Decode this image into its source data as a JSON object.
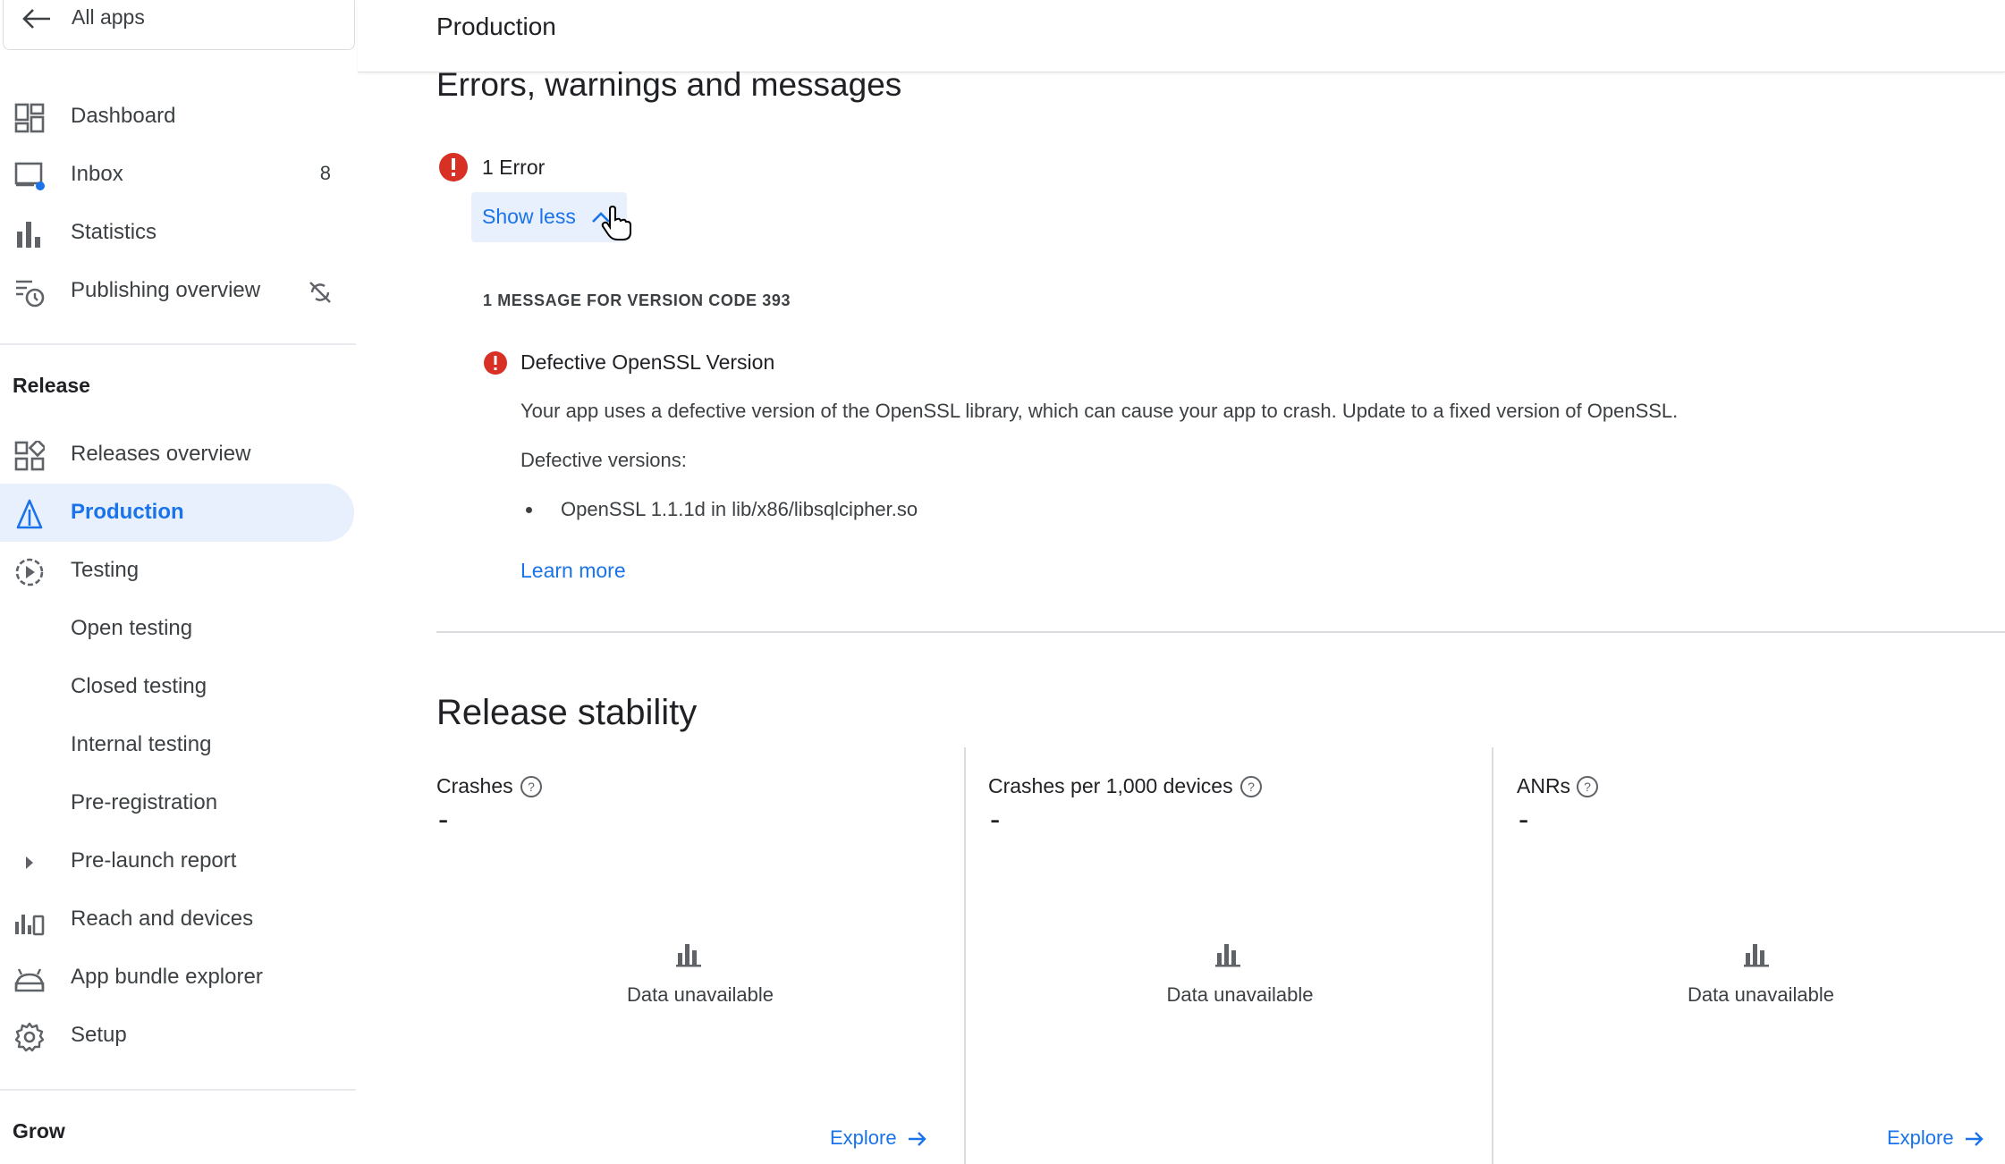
{
  "sidebar": {
    "all_apps": "All apps",
    "items": [
      {
        "label": "Dashboard",
        "icon": "dashboard-icon"
      },
      {
        "label": "Inbox",
        "icon": "inbox-icon",
        "count": "8"
      },
      {
        "label": "Statistics",
        "icon": "bar-chart-icon"
      },
      {
        "label": "Publishing overview",
        "icon": "publishing-overview-icon"
      }
    ],
    "release_heading": "Release",
    "release_items": [
      {
        "label": "Releases overview",
        "icon": "releases-overview-icon"
      },
      {
        "label": "Production",
        "icon": "production-icon",
        "active": true
      },
      {
        "label": "Testing",
        "icon": "testing-icon"
      },
      {
        "label": "Open testing"
      },
      {
        "label": "Closed testing"
      },
      {
        "label": "Internal testing"
      },
      {
        "label": "Pre-registration"
      },
      {
        "label": "Pre-launch report",
        "icon": "expand-arrow-icon"
      },
      {
        "label": "Reach and devices",
        "icon": "reach-devices-icon"
      },
      {
        "label": "App bundle explorer",
        "icon": "app-bundle-icon"
      },
      {
        "label": "Setup",
        "icon": "settings-icon"
      }
    ],
    "grow_heading": "Grow"
  },
  "header": {
    "title": "Production"
  },
  "errors": {
    "heading": "Errors, warnings and messages",
    "summary": "1 Error",
    "show_less": "Show less",
    "version_heading": "1 MESSAGE FOR VERSION CODE 393",
    "item_title": "Defective OpenSSL Version",
    "description": "Your app uses a defective version of the OpenSSL library, which can cause your app to crash. Update to a fixed version of OpenSSL.",
    "defective_label": "Defective versions:",
    "versions": [
      "OpenSSL 1.1.1d in lib/x86/libsqlcipher.so"
    ],
    "learn_more": "Learn more"
  },
  "stability": {
    "heading": "Release stability",
    "cards": [
      {
        "title": "Crashes",
        "value": "-",
        "empty": "Data unavailable",
        "explore": "Explore"
      },
      {
        "title": "Crashes per 1,000 devices",
        "value": "-",
        "empty": "Data unavailable",
        "explore": ""
      },
      {
        "title": "ANRs",
        "value": "-",
        "empty": "Data unavailable",
        "explore": "Explore"
      }
    ]
  },
  "colors": {
    "accent": "#1a73e8",
    "error": "#d93025",
    "active_bg": "#e8f0fe"
  }
}
